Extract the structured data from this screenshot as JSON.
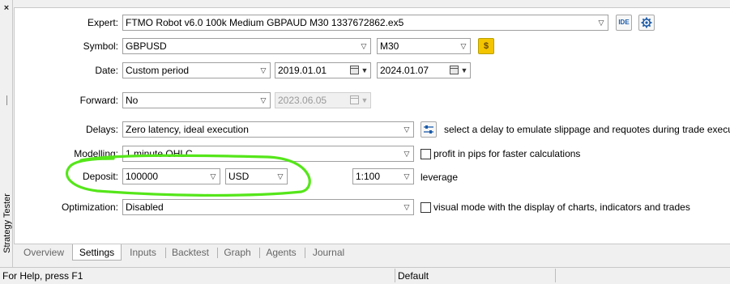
{
  "panel": {
    "title": "Strategy Tester",
    "close_glyph": "×"
  },
  "fields": {
    "expert": {
      "label": "Expert:",
      "value": "FTMO Robot v6.0 100k Medium GBPAUD M30 1337672862.ex5",
      "ide_label": "IDE"
    },
    "symbol": {
      "label": "Symbol:",
      "value": "GBPUSD",
      "timeframe": "M30",
      "dollar_glyph": "$"
    },
    "date": {
      "label": "Date:",
      "mode": "Custom period",
      "from": "2019.01.01",
      "to": "2024.01.07"
    },
    "forward": {
      "label": "Forward:",
      "mode": "No",
      "date": "2023.06.05"
    },
    "delays": {
      "label": "Delays:",
      "value": "Zero latency, ideal execution",
      "hint": "select a delay to emulate slippage and requotes during trade execution"
    },
    "modelling": {
      "label": "Modelling:",
      "value": "1 minute OHLC",
      "checkbox_label": "profit in pips for faster calculations"
    },
    "deposit": {
      "label": "Deposit:",
      "amount": "100000",
      "currency": "USD",
      "leverage_value": "1:100",
      "leverage_label": "leverage"
    },
    "optimization": {
      "label": "Optimization:",
      "value": "Disabled",
      "checkbox_label": "visual mode with the display of charts, indicators and trades"
    }
  },
  "tabs": [
    {
      "label": "Overview",
      "active": false
    },
    {
      "label": "Settings",
      "active": true
    },
    {
      "label": "Inputs",
      "active": false
    },
    {
      "label": "Backtest",
      "active": false
    },
    {
      "label": "Graph",
      "active": false
    },
    {
      "label": "Agents",
      "active": false
    },
    {
      "label": "Journal",
      "active": false
    }
  ],
  "statusbar": {
    "help": "For Help, press F1",
    "profile": "Default"
  },
  "colors": {
    "highlight": "#55e61a",
    "accent": "#1a5aa8",
    "dollar_button": "#f3c400"
  }
}
